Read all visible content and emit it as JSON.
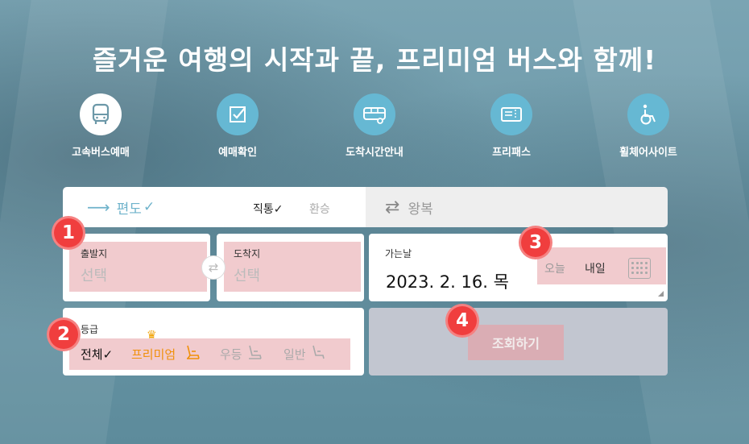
{
  "headline": "즐거운 여행의 시작과 끝, 프리미엄 버스와 함께!",
  "menu": [
    {
      "label": "고속버스예매",
      "icon": "bus-icon",
      "active": true
    },
    {
      "label": "예매확인",
      "icon": "checkbox-icon"
    },
    {
      "label": "도착시간안내",
      "icon": "bus-side-icon"
    },
    {
      "label": "프리패스",
      "icon": "ticket-icon"
    },
    {
      "label": "휠체어사이트",
      "icon": "wheelchair-icon"
    }
  ],
  "trip": {
    "oneway_label": "편도",
    "oneway_check": "✓",
    "direct_label": "직통✓",
    "transfer_label": "환승",
    "roundtrip_label": "왕복"
  },
  "departure": {
    "label": "출발지",
    "value": "선택"
  },
  "arrival": {
    "label": "도착지",
    "value": "선택"
  },
  "date": {
    "label": "가는날",
    "value": "2023. 2. 16. 목",
    "today": "오늘",
    "tomorrow": "내일"
  },
  "grade": {
    "label": "등급",
    "all": "전체✓",
    "premium": "프리미엄",
    "deluxe": "우등",
    "normal": "일반"
  },
  "search_label": "조회하기",
  "badges": [
    "1",
    "2",
    "3",
    "4"
  ],
  "colors": {
    "accent": "#6fb3cb",
    "badge": "#f03e3e",
    "premium": "#f0900a",
    "highlight": "#e6a0a5"
  }
}
